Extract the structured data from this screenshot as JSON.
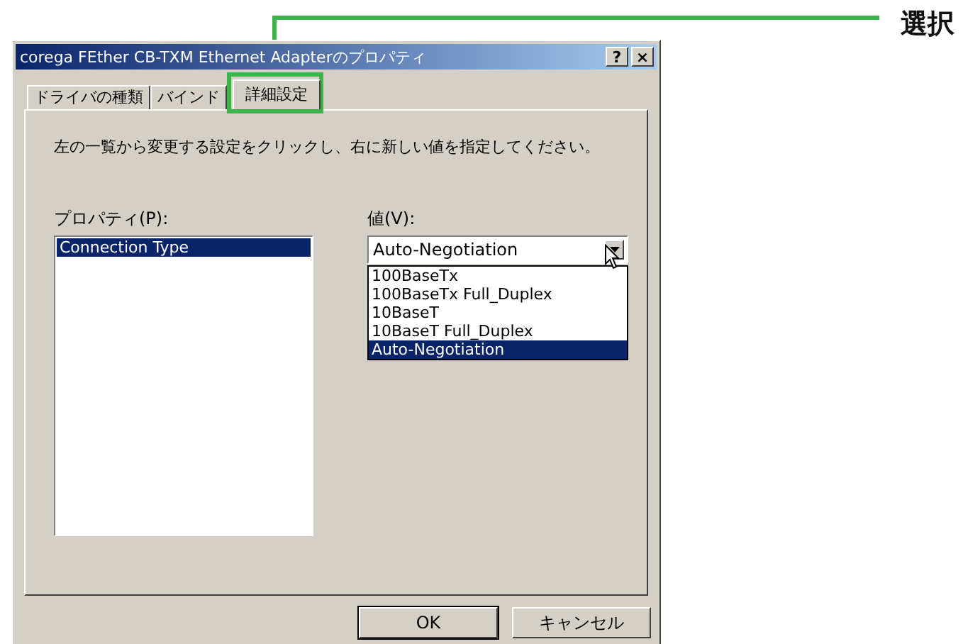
{
  "annotation": {
    "label": "選択"
  },
  "window": {
    "title": "corega FEther CB-TXM Ethernet Adapterのプロパティ",
    "help_button": "?",
    "close_button": "×"
  },
  "tabs": [
    {
      "label": "ドライバの種類",
      "selected": false
    },
    {
      "label": "バインド",
      "selected": false
    },
    {
      "label": "詳細設定",
      "selected": true
    }
  ],
  "instruction": "左の一覧から変更する設定をクリックし、右に新しい値を指定してください。",
  "property_list": {
    "label": "プロパティ(P):",
    "items": [
      {
        "label": "Connection Type",
        "selected": true
      }
    ]
  },
  "value_combo": {
    "label": "値(V):",
    "value": "Auto-Negotiation",
    "expanded": true,
    "options": [
      {
        "label": "100BaseTx",
        "selected": false
      },
      {
        "label": "100BaseTx Full_Duplex",
        "selected": false
      },
      {
        "label": "10BaseT",
        "selected": false
      },
      {
        "label": "10BaseT Full_Duplex",
        "selected": false
      },
      {
        "label": "Auto-Negotiation",
        "selected": true
      }
    ]
  },
  "buttons": [
    {
      "label": "OK",
      "default": true
    },
    {
      "label": "キャンセル",
      "default": false
    }
  ]
}
